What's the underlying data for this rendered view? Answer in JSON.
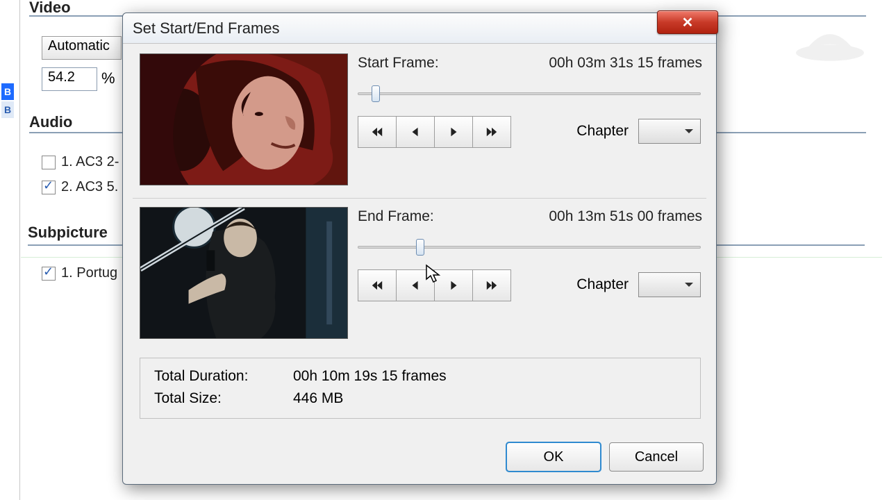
{
  "bg": {
    "video_header": "Video",
    "audio_header": "Audio",
    "subpicture_header": "Subpicture",
    "mode_combo": "Automatic",
    "percent_value": "54.2",
    "percent_symbol": "%",
    "badge1": "B",
    "badge2": "B",
    "audio_item1": "1. AC3 2-",
    "audio_item2": "2. AC3 5.",
    "sub_item1": "1. Portug"
  },
  "dialog": {
    "title": "Set Start/End Frames",
    "start": {
      "label": "Start Frame:",
      "value": "00h 03m 31s 15 frames",
      "chapter_label": "Chapter",
      "slider_pos_pct": 4
    },
    "end": {
      "label": "End Frame:",
      "value": "00h 13m 51s 00 frames",
      "chapter_label": "Chapter",
      "slider_pos_pct": 17
    },
    "totals": {
      "duration_label": "Total Duration:",
      "duration_value": "00h 10m 19s 15 frames",
      "size_label": "Total Size:",
      "size_value": "446 MB"
    },
    "ok": "OK",
    "cancel": "Cancel"
  }
}
